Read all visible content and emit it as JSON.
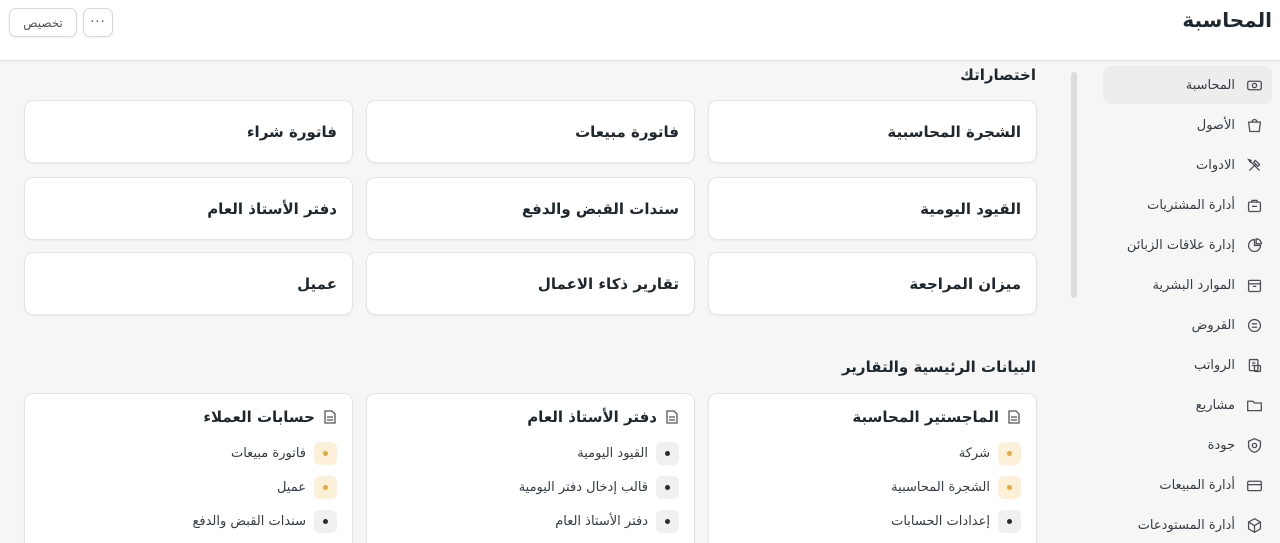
{
  "header": {
    "title": "المحاسبة",
    "customize_label": "تخصيص",
    "more_label": "···"
  },
  "sidebar": {
    "items": [
      {
        "label": "المحاسبة",
        "icon": "accounting-icon",
        "active": true
      },
      {
        "label": "الأصول",
        "icon": "assets-icon"
      },
      {
        "label": "الادوات",
        "icon": "tools-icon"
      },
      {
        "label": "أدارة المشتريات",
        "icon": "buying-icon"
      },
      {
        "label": "إدارة علاقات الزبائن",
        "icon": "crm-icon"
      },
      {
        "label": "الموارد البشرية",
        "icon": "hr-icon"
      },
      {
        "label": "القروض",
        "icon": "loans-icon"
      },
      {
        "label": "الرواتب",
        "icon": "payroll-icon"
      },
      {
        "label": "مشاريع",
        "icon": "projects-icon"
      },
      {
        "label": "جودة",
        "icon": "quality-icon"
      },
      {
        "label": "أدارة المبيعات",
        "icon": "selling-icon"
      },
      {
        "label": "أدارة المستودعات",
        "icon": "stock-icon"
      }
    ]
  },
  "shortcuts": {
    "title": "اختصاراتك",
    "items": [
      "الشجرة المحاسبية",
      "فاتورة مبيعات",
      "فاتورة شراء",
      "القيود اليومية",
      "سندات القبض والدفع",
      "دفتر الأستاذ العام",
      "ميزان المراجعة",
      "تقارير ذكاء الاعمال",
      "عميل"
    ]
  },
  "reports": {
    "title": "البيانات الرئيسية والتقارير",
    "cards": [
      {
        "title": "الماجستير المحاسبة",
        "links": [
          {
            "label": "شركة",
            "dot": "orange"
          },
          {
            "label": "الشجرة المحاسبية",
            "dot": "orange"
          },
          {
            "label": "إعدادات الحسابات",
            "dot": "gray"
          }
        ]
      },
      {
        "title": "دفتر الأستاذ العام",
        "links": [
          {
            "label": "القيود اليومية",
            "dot": "gray"
          },
          {
            "label": "قالب إدخال دفتر اليومية",
            "dot": "gray"
          },
          {
            "label": "دفتر الأستاذ العام",
            "dot": "gray"
          }
        ]
      },
      {
        "title": "حسابات العملاء",
        "links": [
          {
            "label": "فاتورة مبيعات",
            "dot": "orange"
          },
          {
            "label": "عميل",
            "dot": "orange"
          },
          {
            "label": "سندات القبض والدفع",
            "dot": "gray"
          }
        ]
      }
    ]
  },
  "colors": {
    "dot_orange": "#e8a83b",
    "dot_orange_bg": "#fdf0d8",
    "active_bg": "#ededed"
  }
}
